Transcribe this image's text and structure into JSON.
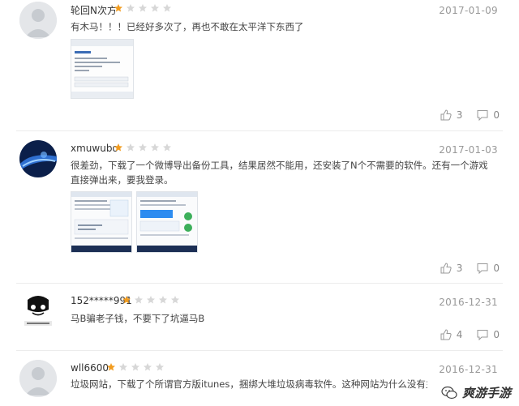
{
  "colors": {
    "star_on": "#f29c1f",
    "star_off": "#d7d7d7",
    "date": "#999999"
  },
  "reviews": [
    {
      "username": "轮回N次方",
      "rating": 1,
      "date": "2017-01-09",
      "text": "有木马！！！已经好多次了，再也不敢在太平洋下东西了",
      "likes": "3",
      "comments": "0"
    },
    {
      "username": "xmuwubo",
      "rating": 1,
      "date": "2017-01-03",
      "text": "很差劲，下载了一个微博导出备份工具，结果居然不能用，还安装了N个不需要的软件。还有一个游戏直接弹出来，要我登录。",
      "likes": "3",
      "comments": "0"
    },
    {
      "username": "152*****991",
      "rating": 1,
      "date": "2016-12-31",
      "text": "马B骗老子钱，不要下了坑逼马B",
      "likes": "4",
      "comments": "0"
    },
    {
      "username": "wll6600",
      "rating": 1,
      "date": "2016-12-31",
      "text": "垃圾网站，下载了个所谓官方版itunes，捆绑大堆垃圾病毒软件。这种网站为什么没有主管部门关闭？",
      "likes": "",
      "comments": ""
    }
  ],
  "watermark": {
    "text": "爽游手游"
  }
}
